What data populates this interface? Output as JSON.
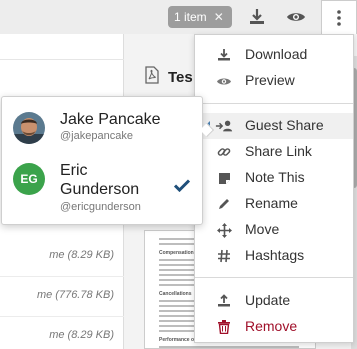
{
  "toolbar": {
    "selection_badge": "1 item",
    "clear_selection_icon": "x-icon",
    "download_icon": "download-icon",
    "preview_icon": "eye-icon",
    "more_icon": "vertical-ellipsis-icon"
  },
  "file_list": {
    "rows": [
      {
        "meta": "me (8.29 KB)"
      },
      {
        "meta": "me (776.78 KB)"
      },
      {
        "meta": "me (8.29 KB)"
      }
    ]
  },
  "preview": {
    "title_partial": "Tes",
    "file_icon": "pdf-icon",
    "document": {
      "headings": [
        "Compensation",
        "Cancellations",
        "Performance of the Event"
      ]
    }
  },
  "menu": {
    "items": [
      {
        "label": "Download",
        "icon": "download-icon"
      },
      {
        "label": "Preview",
        "icon": "eye-icon"
      },
      {
        "label": "Guest Share",
        "icon": "guest-share-icon"
      },
      {
        "label": "Share Link",
        "icon": "link-icon"
      },
      {
        "label": "Note This",
        "icon": "note-icon"
      },
      {
        "label": "Rename",
        "icon": "pencil-icon"
      },
      {
        "label": "Move",
        "icon": "move-icon"
      },
      {
        "label": "Hashtags",
        "icon": "hashtag-icon"
      },
      {
        "label": "Update",
        "icon": "upload-icon"
      },
      {
        "label": "Remove",
        "icon": "trash-icon"
      }
    ]
  },
  "share_popover": {
    "people": [
      {
        "name": "Jake Pancake",
        "handle": "@jakepancake",
        "avatar": "photo"
      },
      {
        "name_line1": "Eric",
        "name_line2": "Gunderson",
        "handle": "@ericgunderson",
        "initials": "EG",
        "selected": true
      }
    ]
  },
  "colors": {
    "accent_green": "#3ba34b",
    "check_blue": "#1f4f7a",
    "danger": "#a0102a",
    "badge_gray": "#9d9d9d"
  }
}
